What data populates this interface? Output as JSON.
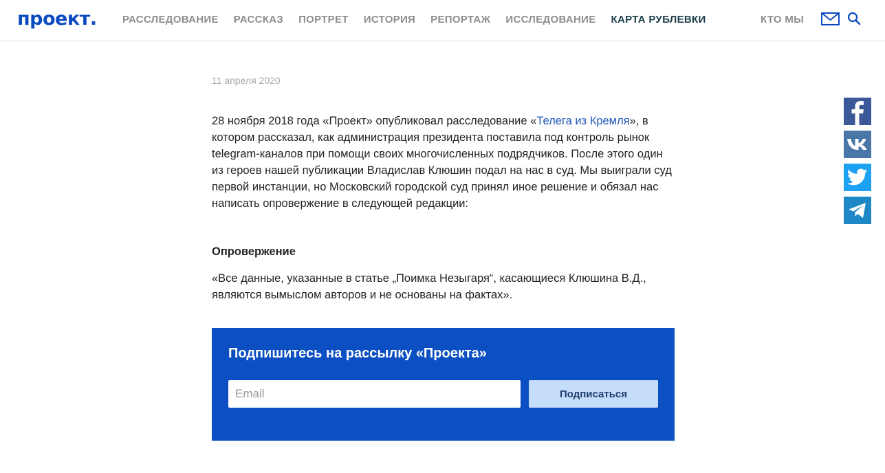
{
  "header": {
    "logo": "проект.",
    "nav": [
      {
        "label": "РАССЛЕДОВАНИЕ"
      },
      {
        "label": "РАССКАЗ"
      },
      {
        "label": "ПОРТРЕТ"
      },
      {
        "label": "ИСТОРИЯ"
      },
      {
        "label": "РЕПОРТАЖ"
      },
      {
        "label": "ИССЛЕДОВАНИЕ"
      },
      {
        "label": "КАРТА РУБЛЕВКИ",
        "active": true
      }
    ],
    "about_label": "КТО МЫ",
    "icons": [
      "mail-icon",
      "search-icon"
    ]
  },
  "article": {
    "date": "11 апреля 2020",
    "p1_before_link": "28 ноября 2018 года «Проект» опубликовал расследование «",
    "p1_link": "Телега из Кремля",
    "p1_after_link": "», в котором рассказал, как администрация президента поставила под контроль рынок telegram-каналов при помощи своих многочисленных подрядчиков. После этого один из героев нашей публикации Владислав Клюшин подал на нас в суд. Мы выиграли суд первой инстанции, но Московский городской суд принял иное решение и обязал нас написать опровержение в следующей редакции:",
    "subhead": "Опровержение",
    "quote": "«Все данные, указанные в статье „Поимка Незыгаря“, касающиеся Клюшина В.Д., являются вымыслом авторов и не основаны на фактах»."
  },
  "newsletter": {
    "title": "Подпишитесь на рассылку «Проекта»",
    "email_placeholder": "Email",
    "email_value": "",
    "button_label": "Подписаться"
  },
  "share": {
    "icons": [
      "facebook-icon",
      "vk-icon",
      "twitter-icon",
      "telegram-icon"
    ]
  },
  "colors": {
    "brand": "#0b4bc0",
    "newsletter_bg": "#0b4fc2",
    "button_bg": "#c6dcfb",
    "link": "#1e56b8"
  }
}
